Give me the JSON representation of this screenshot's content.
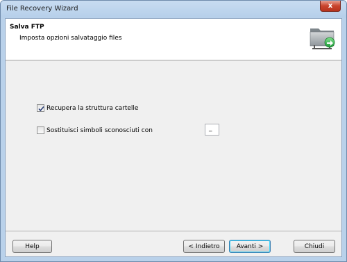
{
  "window": {
    "title": "File Recovery Wizard",
    "close_label": "x"
  },
  "header": {
    "title": "Salva FTP",
    "subtitle": "Imposta opzioni salvataggio files",
    "icon": "folder-network-icon"
  },
  "options": {
    "preserve_structure": {
      "label": "Recupera la struttura cartelle",
      "checked": true
    },
    "replace_symbols": {
      "label": "Sostituisci simboli sconosciuti con",
      "checked": false,
      "value": "_"
    }
  },
  "buttons": {
    "help": "Help",
    "back": "< Indietro",
    "next": "Avanti >",
    "close": "Chiudi"
  },
  "colors": {
    "accent": "#3c7fb1",
    "titlebar": "#b9d1ea",
    "close": "#c9442d",
    "folder": "#9aa0a4",
    "arrow": "#2db34a"
  }
}
